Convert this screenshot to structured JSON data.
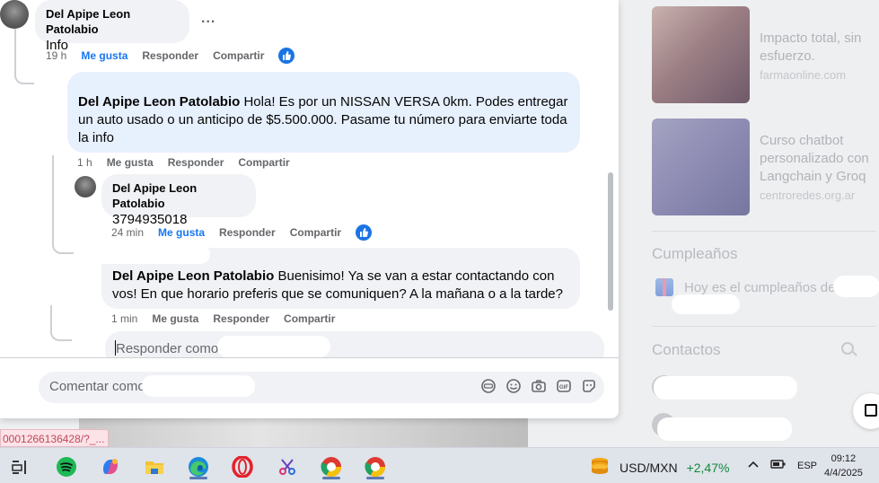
{
  "right_panel": {
    "ads": [
      {
        "title": "Impacto total, sin esfuerzo.",
        "source": "farmaonline.com"
      },
      {
        "title": "Curso chatbot personalizado con Langchain y Groq",
        "source": "centroredes.org.ar"
      }
    ],
    "birthdays_heading": "Cumpleaños",
    "birthday_text": "Hoy es el cumpleaños de",
    "contacts_heading": "Contactos"
  },
  "thread": {
    "comment1": {
      "author": "Del Apipe Leon Patolabio",
      "text": "Info",
      "time": "19 h",
      "like": "Me gusta",
      "reply": "Responder",
      "share": "Compartir",
      "more": "..."
    },
    "reply1": {
      "author": "Del Apipe Leon Patolabio",
      "text": "Hola! Es por un NISSAN VERSA 0km. Podes entregar un auto usado o un anticipo de $5.500.000. Pasame tu número para enviarte toda la info",
      "time": "1 h",
      "like": "Me gusta",
      "reply": "Responder",
      "share": "Compartir"
    },
    "comment2": {
      "author": "Del Apipe Leon Patolabio",
      "text": "3794935018",
      "time": "24 min",
      "like": "Me gusta",
      "reply": "Responder",
      "share": "Compartir"
    },
    "reply2": {
      "author": "Del Apipe Leon Patolabio",
      "text": "Buenisimo! Ya se van a estar contactando con vos! En que horario preferis que se comuniquen? A la mañana o a la tarde?",
      "time": "1 min",
      "like": "Me gusta",
      "reply": "Responder",
      "share": "Compartir"
    },
    "reply_placeholder": "Responder como"
  },
  "comment_box": {
    "placeholder": "Comentar como"
  },
  "url_tooltip": "0001266136428/?_...",
  "taskbar": {
    "ticker_pair": "USD/MXN",
    "ticker_change": "+2,47%",
    "language": "ESP",
    "time": "09:12",
    "date": "4/4/2025"
  },
  "colors": {
    "accent": "#1877f2",
    "positive": "#128a3a"
  }
}
